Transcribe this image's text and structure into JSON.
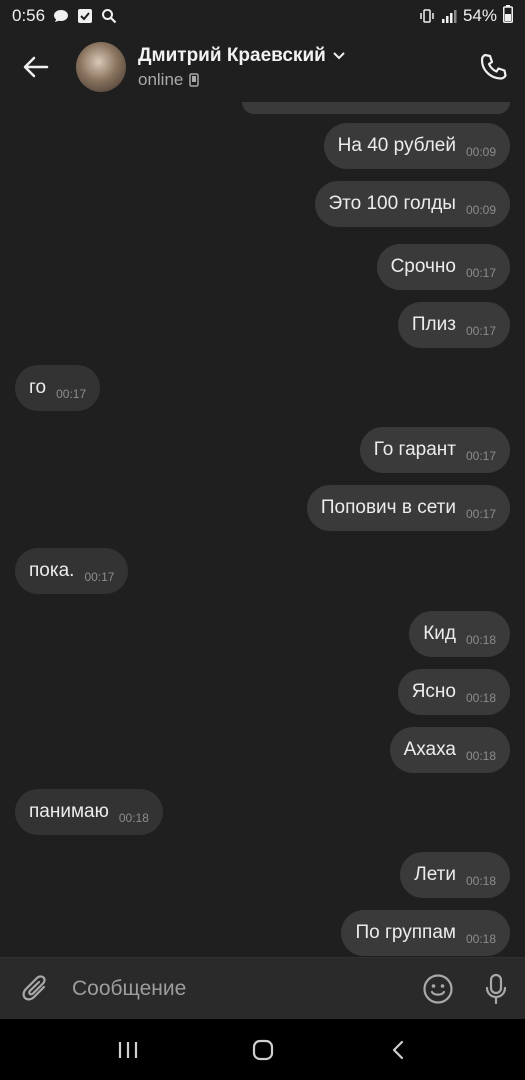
{
  "status_bar": {
    "time": "0:56",
    "battery": "54%"
  },
  "header": {
    "contact_name": "Дмитрий Краевский",
    "status": "online"
  },
  "messages": [
    {
      "dir": "out",
      "text": "На 40 рублей",
      "time": "00:09"
    },
    {
      "dir": "out",
      "text": "Это 100 голды",
      "time": "00:09"
    },
    {
      "dir": "out",
      "text": "Срочно",
      "time": "00:17"
    },
    {
      "dir": "out",
      "text": "Плиз",
      "time": "00:17"
    },
    {
      "dir": "in",
      "text": "го",
      "time": "00:17"
    },
    {
      "dir": "out",
      "text": "Го гарант",
      "time": "00:17"
    },
    {
      "dir": "out",
      "text": "Попович в сети",
      "time": "00:17"
    },
    {
      "dir": "in",
      "text": "пока.",
      "time": "00:17"
    },
    {
      "dir": "out",
      "text": "Кид",
      "time": "00:18"
    },
    {
      "dir": "out",
      "text": "Ясно",
      "time": "00:18"
    },
    {
      "dir": "out",
      "text": "Ахаха",
      "time": "00:18"
    },
    {
      "dir": "in",
      "text": "панимаю",
      "time": "00:18"
    },
    {
      "dir": "out",
      "text": "Лети",
      "time": "00:18"
    },
    {
      "dir": "out",
      "text": "По группам",
      "time": "00:18"
    }
  ],
  "composer": {
    "placeholder": "Сообщение"
  },
  "icons": {
    "back": "arrow-left-icon",
    "call": "phone-icon",
    "attach": "paperclip-icon",
    "emoji": "smiley-icon",
    "mic": "microphone-icon",
    "dropdown": "chevron-down-icon",
    "device": "mobile-device-icon"
  },
  "colors": {
    "background": "#1f1f1f",
    "bubble_out": "#3a3a3a",
    "bubble_in": "#333333",
    "composer": "#2a2a2a"
  }
}
